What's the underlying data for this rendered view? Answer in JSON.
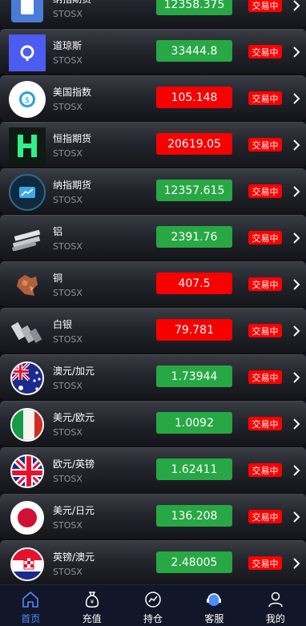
{
  "rows": [
    {
      "name": "纳指期货",
      "sub": "STOSX",
      "price": "12358.375",
      "dir": "up",
      "badge": "交易中",
      "icon": "index-icon"
    },
    {
      "name": "道琼斯",
      "sub": "STOSX",
      "price": "33444.8",
      "dir": "up",
      "badge": "交易中",
      "icon": "dow-logo-icon"
    },
    {
      "name": "美国指数",
      "sub": "STOSX",
      "price": "105.148",
      "dir": "down",
      "badge": "交易中",
      "icon": "dollar-coin-icon"
    },
    {
      "name": "恒指期货",
      "sub": "STOSX",
      "price": "20619.05",
      "dir": "down",
      "badge": "交易中",
      "icon": "hang-seng-logo-icon"
    },
    {
      "name": "纳指期货",
      "sub": "STOSX",
      "price": "12357.615",
      "dir": "up",
      "badge": "交易中",
      "icon": "trend-chart-icon"
    },
    {
      "name": "铝",
      "sub": "STOSX",
      "price": "2391.76",
      "dir": "up",
      "badge": "交易中",
      "icon": "aluminum-bars-icon"
    },
    {
      "name": "铜",
      "sub": "STOSX",
      "price": "407.5",
      "dir": "down",
      "badge": "交易中",
      "icon": "copper-ore-icon"
    },
    {
      "name": "白银",
      "sub": "STOSX",
      "price": "79.781",
      "dir": "down",
      "badge": "交易中",
      "icon": "silver-bars-icon"
    },
    {
      "name": "澳元/加元",
      "sub": "STOSX",
      "price": "1.73944",
      "dir": "up",
      "badge": "交易中",
      "icon": "flag-australia-icon"
    },
    {
      "name": "美元/欧元",
      "sub": "STOSX",
      "price": "1.0092",
      "dir": "up",
      "badge": "交易中",
      "icon": "flag-italy-icon"
    },
    {
      "name": "欧元/英镑",
      "sub": "STOSX",
      "price": "1.62411",
      "dir": "up",
      "badge": "交易中",
      "icon": "flag-uk-icon"
    },
    {
      "name": "美元/日元",
      "sub": "STOSX",
      "price": "136.208",
      "dir": "up",
      "badge": "交易中",
      "icon": "flag-japan-icon"
    },
    {
      "name": "英镑/澳元",
      "sub": "STOSX",
      "price": "2.48005",
      "dir": "up",
      "badge": "交易中",
      "icon": "flag-croatia-icon"
    }
  ],
  "tabs": [
    {
      "label": "首页",
      "icon": "home-icon",
      "active": true
    },
    {
      "label": "充值",
      "icon": "money-bag-icon",
      "active": false
    },
    {
      "label": "持仓",
      "icon": "chart-icon",
      "active": false
    },
    {
      "label": "客服",
      "icon": "support-icon",
      "active": false
    },
    {
      "label": "我的",
      "icon": "user-icon",
      "active": false
    }
  ],
  "colors": {
    "up": "#27a844",
    "down": "#f80000",
    "badge": "#ff0000",
    "tab_active": "#4f8cff",
    "tabbar_bg": "#121629"
  }
}
